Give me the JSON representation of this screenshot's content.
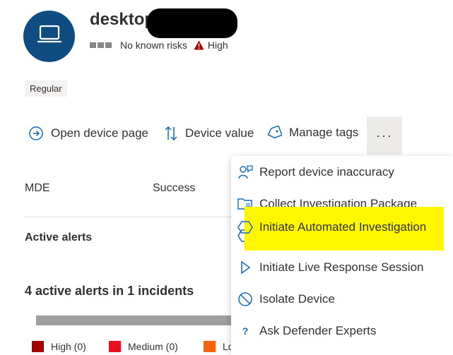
{
  "device": {
    "name": "desktop",
    "risk_text": "No known risks",
    "exposure_level": "High",
    "tag": "Regular"
  },
  "toolbar": {
    "open_device_page": "Open device page",
    "device_value": "Device value",
    "manage_tags": "Manage tags",
    "more": "···"
  },
  "details": {
    "mde_label": "MDE",
    "mde_value": "Success",
    "active_alerts_label": "Active alerts",
    "alerts_summary": "4 active alerts in 1 incidents"
  },
  "legend": [
    {
      "label": "High (0)",
      "color": "#a80000"
    },
    {
      "label": "Medium (0)",
      "color": "#e81123"
    },
    {
      "label": "Lo",
      "color": "#f7630c"
    }
  ],
  "menu": {
    "items": [
      {
        "label": "Report device inaccuracy",
        "icon": "person-feedback-icon"
      },
      {
        "label": "Collect Investigation Package",
        "icon": "folder-list-icon"
      },
      {
        "label": "Initiate Automated Investigation",
        "icon": "hexagon-icon"
      },
      {
        "label": "Initiate Live Response Session",
        "icon": "play-icon"
      },
      {
        "label": "Isolate Device",
        "icon": "block-icon"
      },
      {
        "label": "Ask Defender Experts",
        "icon": "question-icon"
      }
    ]
  },
  "colors": {
    "avatar_bg": "#0f4c81",
    "accent": "#0f6cbd",
    "highlight": "#fff700",
    "warning": "#a80000"
  }
}
